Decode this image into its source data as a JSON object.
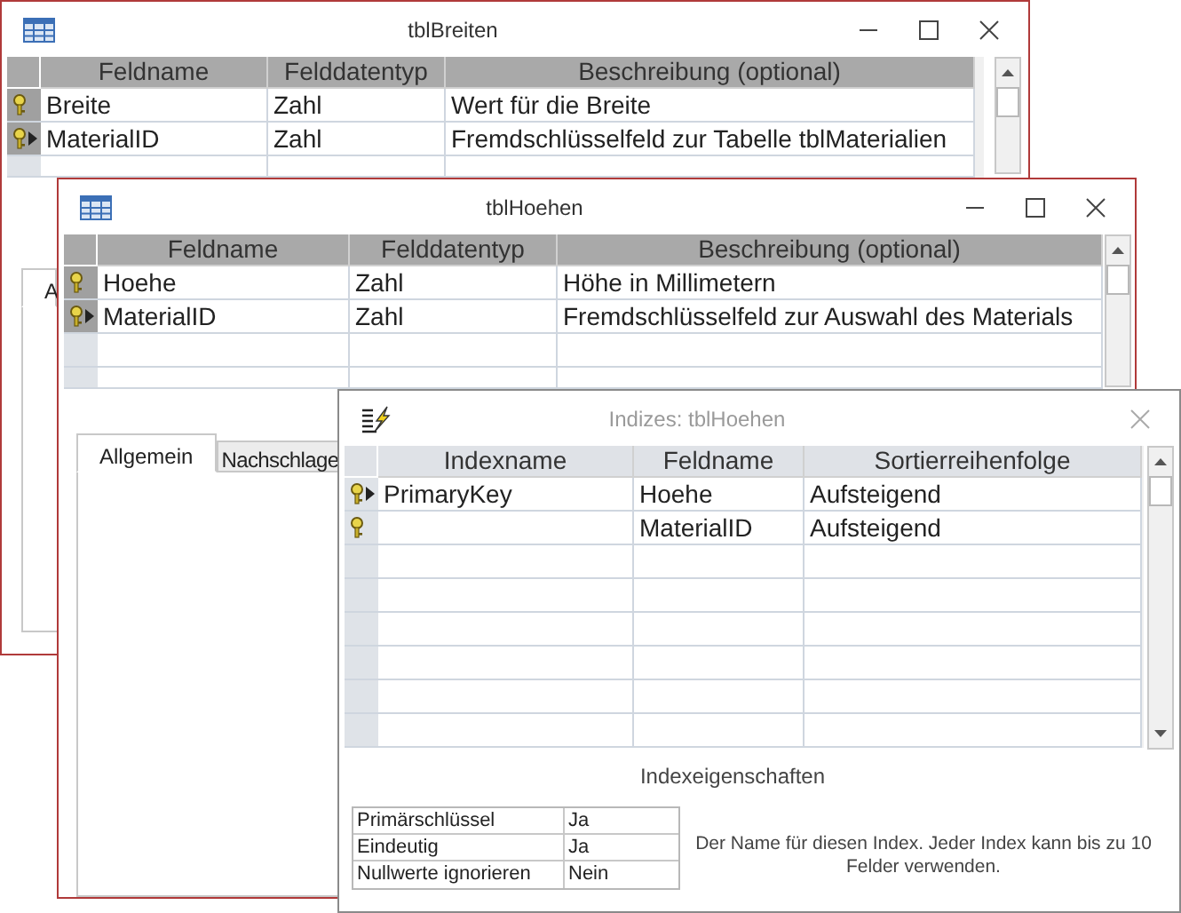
{
  "windows": [
    {
      "title": "tblBreiten",
      "kind": "design",
      "active": true,
      "columns": [
        "Feldname",
        "Felddatentyp",
        "Beschreibung (optional)"
      ],
      "rows": [
        {
          "cells": [
            "Breite",
            "Zahl",
            "Wert für die Breite"
          ],
          "key": true,
          "current": false
        },
        {
          "cells": [
            "MaterialID",
            "Zahl",
            "Fremdschlüsselfeld zur Tabelle tblMaterialien"
          ],
          "key": true,
          "current": true
        }
      ],
      "tabs": [
        {
          "label": "A",
          "selected": true
        }
      ]
    },
    {
      "title": "tblHoehen",
      "kind": "design",
      "active": true,
      "columns": [
        "Feldname",
        "Felddatentyp",
        "Beschreibung (optional)"
      ],
      "rows": [
        {
          "cells": [
            "Hoehe",
            "Zahl",
            "Höhe in Millimetern"
          ],
          "key": true,
          "current": false
        },
        {
          "cells": [
            "MaterialID",
            "Zahl",
            "Fremdschlüsselfeld zur Auswahl des Materials"
          ],
          "key": true,
          "current": true
        }
      ],
      "tabs": [
        {
          "label": "Allgemein",
          "selected": true
        },
        {
          "label": "Nachschlage",
          "selected": false
        }
      ]
    },
    {
      "title": "Indizes: tblHoehen",
      "kind": "indexes",
      "active": false,
      "columns": [
        "Indexname",
        "Feldname",
        "Sortierreihenfolge"
      ],
      "rows": [
        {
          "cells": [
            "PrimaryKey",
            "Hoehe",
            "Aufsteigend"
          ],
          "key": true,
          "current": true
        },
        {
          "cells": [
            "",
            "MaterialID",
            "Aufsteigend"
          ],
          "key": true,
          "current": false
        }
      ],
      "section_title": "Indexeigenschaften",
      "properties": [
        {
          "label": "Primärschlüssel",
          "value": "Ja"
        },
        {
          "label": "Eindeutig",
          "value": "Ja"
        },
        {
          "label": "Nullwerte ignorieren",
          "value": "Nein"
        }
      ],
      "help_text": "Der Name für diesen Index. Jeder Index kann bis zu 10 Felder verwenden."
    }
  ]
}
